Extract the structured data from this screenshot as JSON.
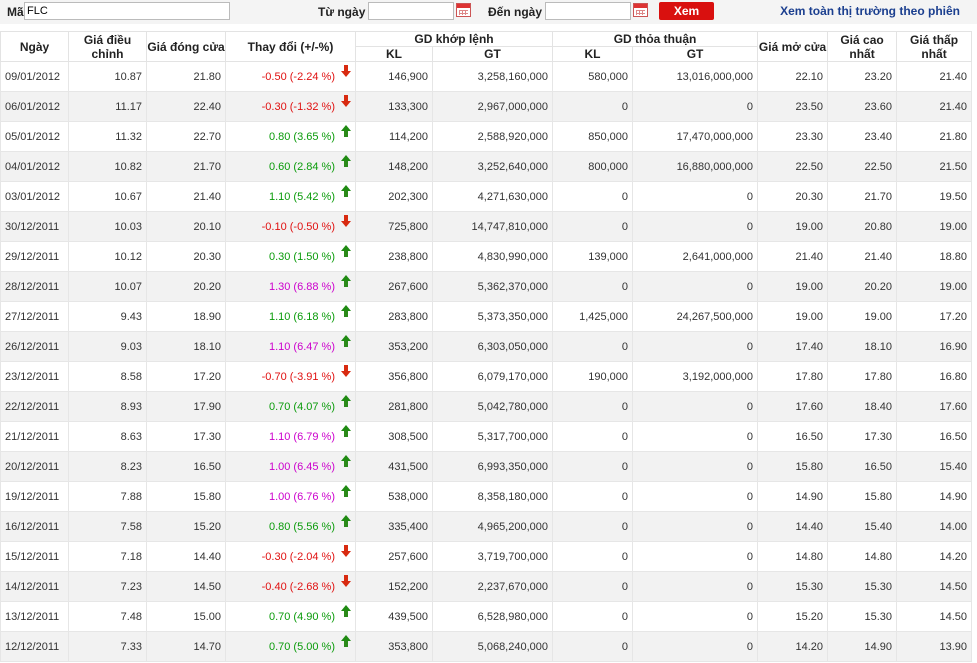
{
  "filter": {
    "symbol_label": "Mã",
    "symbol_value": "FLC",
    "from_label": "Từ ngày",
    "from_value": "",
    "to_label": "Đến ngày",
    "to_value": "",
    "view_button": "Xem",
    "market_link": "Xem toàn thị trường theo phiên"
  },
  "headers": {
    "date": "Ngày",
    "adjusted": "Giá điều chỉnh",
    "close": "Giá đóng cửa",
    "change": "Thay đổi (+/-%)",
    "matched": "GD khớp lệnh",
    "negotiated": "GD thỏa thuận",
    "kl": "KL",
    "gt": "GT",
    "open": "Giá mở cửa",
    "high": "Giá cao nhất",
    "low": "Giá thấp nhất"
  },
  "colors": {
    "up": "#0a9b0a",
    "down": "#e01010",
    "ceiling": "#cc00cc",
    "button": "#d9100f",
    "link": "#1b3f8f"
  },
  "rows": [
    {
      "date": "09/01/2012",
      "adj": "10.87",
      "close": "21.80",
      "change": "-0.50 (-2.24 %)",
      "dir": "down",
      "m_kl": "146,900",
      "m_gt": "3,258,160,000",
      "n_kl": "580,000",
      "n_gt": "13,016,000,000",
      "open": "22.10",
      "high": "23.20",
      "low": "21.40"
    },
    {
      "date": "06/01/2012",
      "adj": "11.17",
      "close": "22.40",
      "change": "-0.30 (-1.32 %)",
      "dir": "down",
      "m_kl": "133,300",
      "m_gt": "2,967,000,000",
      "n_kl": "0",
      "n_gt": "0",
      "open": "23.50",
      "high": "23.60",
      "low": "21.40"
    },
    {
      "date": "05/01/2012",
      "adj": "11.32",
      "close": "22.70",
      "change": "0.80 (3.65 %)",
      "dir": "up",
      "m_kl": "114,200",
      "m_gt": "2,588,920,000",
      "n_kl": "850,000",
      "n_gt": "17,470,000,000",
      "open": "23.30",
      "high": "23.40",
      "low": "21.80"
    },
    {
      "date": "04/01/2012",
      "adj": "10.82",
      "close": "21.70",
      "change": "0.60 (2.84 %)",
      "dir": "up",
      "m_kl": "148,200",
      "m_gt": "3,252,640,000",
      "n_kl": "800,000",
      "n_gt": "16,880,000,000",
      "open": "22.50",
      "high": "22.50",
      "low": "21.50"
    },
    {
      "date": "03/01/2012",
      "adj": "10.67",
      "close": "21.40",
      "change": "1.10 (5.42 %)",
      "dir": "up",
      "m_kl": "202,300",
      "m_gt": "4,271,630,000",
      "n_kl": "0",
      "n_gt": "0",
      "open": "20.30",
      "high": "21.70",
      "low": "19.50"
    },
    {
      "date": "30/12/2011",
      "adj": "10.03",
      "close": "20.10",
      "change": "-0.10 (-0.50 %)",
      "dir": "down",
      "m_kl": "725,800",
      "m_gt": "14,747,810,000",
      "n_kl": "0",
      "n_gt": "0",
      "open": "19.00",
      "high": "20.80",
      "low": "19.00"
    },
    {
      "date": "29/12/2011",
      "adj": "10.12",
      "close": "20.30",
      "change": "0.30 (1.50 %)",
      "dir": "up",
      "m_kl": "238,800",
      "m_gt": "4,830,990,000",
      "n_kl": "139,000",
      "n_gt": "2,641,000,000",
      "open": "21.40",
      "high": "21.40",
      "low": "18.80"
    },
    {
      "date": "28/12/2011",
      "adj": "10.07",
      "close": "20.20",
      "change": "1.30 (6.88 %)",
      "dir": "ceil",
      "m_kl": "267,600",
      "m_gt": "5,362,370,000",
      "n_kl": "0",
      "n_gt": "0",
      "open": "19.00",
      "high": "20.20",
      "low": "19.00"
    },
    {
      "date": "27/12/2011",
      "adj": "9.43",
      "close": "18.90",
      "change": "1.10 (6.18 %)",
      "dir": "up",
      "m_kl": "283,800",
      "m_gt": "5,373,350,000",
      "n_kl": "1,425,000",
      "n_gt": "24,267,500,000",
      "open": "19.00",
      "high": "19.00",
      "low": "17.20"
    },
    {
      "date": "26/12/2011",
      "adj": "9.03",
      "close": "18.10",
      "change": "1.10 (6.47 %)",
      "dir": "ceil",
      "m_kl": "353,200",
      "m_gt": "6,303,050,000",
      "n_kl": "0",
      "n_gt": "0",
      "open": "17.40",
      "high": "18.10",
      "low": "16.90"
    },
    {
      "date": "23/12/2011",
      "adj": "8.58",
      "close": "17.20",
      "change": "-0.70 (-3.91 %)",
      "dir": "down",
      "m_kl": "356,800",
      "m_gt": "6,079,170,000",
      "n_kl": "190,000",
      "n_gt": "3,192,000,000",
      "open": "17.80",
      "high": "17.80",
      "low": "16.80"
    },
    {
      "date": "22/12/2011",
      "adj": "8.93",
      "close": "17.90",
      "change": "0.70 (4.07 %)",
      "dir": "up",
      "m_kl": "281,800",
      "m_gt": "5,042,780,000",
      "n_kl": "0",
      "n_gt": "0",
      "open": "17.60",
      "high": "18.40",
      "low": "17.60"
    },
    {
      "date": "21/12/2011",
      "adj": "8.63",
      "close": "17.30",
      "change": "1.10 (6.79 %)",
      "dir": "ceil",
      "m_kl": "308,500",
      "m_gt": "5,317,700,000",
      "n_kl": "0",
      "n_gt": "0",
      "open": "16.50",
      "high": "17.30",
      "low": "16.50"
    },
    {
      "date": "20/12/2011",
      "adj": "8.23",
      "close": "16.50",
      "change": "1.00 (6.45 %)",
      "dir": "ceil",
      "m_kl": "431,500",
      "m_gt": "6,993,350,000",
      "n_kl": "0",
      "n_gt": "0",
      "open": "15.80",
      "high": "16.50",
      "low": "15.40"
    },
    {
      "date": "19/12/2011",
      "adj": "7.88",
      "close": "15.80",
      "change": "1.00 (6.76 %)",
      "dir": "ceil",
      "m_kl": "538,000",
      "m_gt": "8,358,180,000",
      "n_kl": "0",
      "n_gt": "0",
      "open": "14.90",
      "high": "15.80",
      "low": "14.90"
    },
    {
      "date": "16/12/2011",
      "adj": "7.58",
      "close": "15.20",
      "change": "0.80 (5.56 %)",
      "dir": "up",
      "m_kl": "335,400",
      "m_gt": "4,965,200,000",
      "n_kl": "0",
      "n_gt": "0",
      "open": "14.40",
      "high": "15.40",
      "low": "14.00"
    },
    {
      "date": "15/12/2011",
      "adj": "7.18",
      "close": "14.40",
      "change": "-0.30 (-2.04 %)",
      "dir": "down",
      "m_kl": "257,600",
      "m_gt": "3,719,700,000",
      "n_kl": "0",
      "n_gt": "0",
      "open": "14.80",
      "high": "14.80",
      "low": "14.20"
    },
    {
      "date": "14/12/2011",
      "adj": "7.23",
      "close": "14.50",
      "change": "-0.40 (-2.68 %)",
      "dir": "down",
      "m_kl": "152,200",
      "m_gt": "2,237,670,000",
      "n_kl": "0",
      "n_gt": "0",
      "open": "15.30",
      "high": "15.30",
      "low": "14.50"
    },
    {
      "date": "13/12/2011",
      "adj": "7.48",
      "close": "15.00",
      "change": "0.70 (4.90 %)",
      "dir": "up",
      "m_kl": "439,500",
      "m_gt": "6,528,980,000",
      "n_kl": "0",
      "n_gt": "0",
      "open": "15.20",
      "high": "15.30",
      "low": "14.50"
    },
    {
      "date": "12/12/2011",
      "adj": "7.33",
      "close": "14.70",
      "change": "0.70 (5.00 %)",
      "dir": "up",
      "m_kl": "353,800",
      "m_gt": "5,068,240,000",
      "n_kl": "0",
      "n_gt": "0",
      "open": "14.20",
      "high": "14.90",
      "low": "13.90"
    }
  ]
}
